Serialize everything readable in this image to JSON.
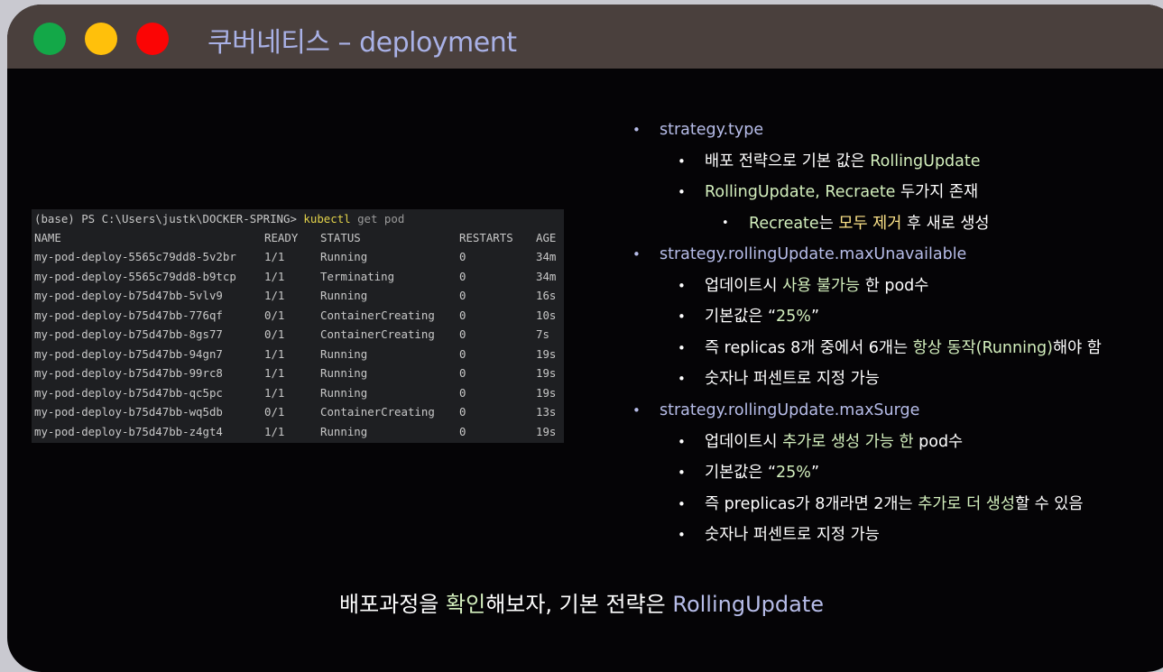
{
  "window": {
    "title": "쿠버네티스 – deployment"
  },
  "terminal": {
    "prompt": "(base) PS C:\\Users\\justk\\DOCKER-SPRING> ",
    "command": "kubectl",
    "args": " get pod",
    "headers": [
      "NAME",
      "READY",
      "STATUS",
      "RESTARTS",
      "AGE"
    ],
    "rows": [
      [
        "my-pod-deploy-5565c79dd8-5v2br",
        "1/1",
        "Running",
        "0",
        "34m"
      ],
      [
        "my-pod-deploy-5565c79dd8-b9tcp",
        "1/1",
        "Terminating",
        "0",
        "34m"
      ],
      [
        "my-pod-deploy-b75d47bb-5vlv9",
        "1/1",
        "Running",
        "0",
        "16s"
      ],
      [
        "my-pod-deploy-b75d47bb-776qf",
        "0/1",
        "ContainerCreating",
        "0",
        "10s"
      ],
      [
        "my-pod-deploy-b75d47bb-8gs77",
        "0/1",
        "ContainerCreating",
        "0",
        "7s"
      ],
      [
        "my-pod-deploy-b75d47bb-94gn7",
        "1/1",
        "Running",
        "0",
        "19s"
      ],
      [
        "my-pod-deploy-b75d47bb-99rc8",
        "1/1",
        "Running",
        "0",
        "19s"
      ],
      [
        "my-pod-deploy-b75d47bb-qc5pc",
        "1/1",
        "Running",
        "0",
        "19s"
      ],
      [
        "my-pod-deploy-b75d47bb-wq5db",
        "0/1",
        "ContainerCreating",
        "0",
        "13s"
      ],
      [
        "my-pod-deploy-b75d47bb-z4gt4",
        "1/1",
        "Running",
        "0",
        "19s"
      ]
    ]
  },
  "notes": {
    "bullet_l1": "•",
    "bullet_l2": "•",
    "bullet_l3": "•",
    "items": [
      {
        "level": 1,
        "parts": [
          {
            "text": "strategy.type",
            "color": "blue"
          }
        ]
      },
      {
        "level": 2,
        "parts": [
          {
            "text": "배포 전략으로 기본 값은 ",
            "color": "white"
          },
          {
            "text": "RollingUpdate",
            "color": "green"
          }
        ]
      },
      {
        "level": 2,
        "parts": [
          {
            "text": "RollingUpdate, Recraete",
            "color": "green"
          },
          {
            "text": " 두가지 존재",
            "color": "white"
          }
        ]
      },
      {
        "level": 3,
        "parts": [
          {
            "text": "Recreate",
            "color": "green"
          },
          {
            "text": "는 ",
            "color": "white"
          },
          {
            "text": "모두 제거",
            "color": "yellow"
          },
          {
            "text": " 후 새로 생성",
            "color": "white"
          }
        ]
      },
      {
        "level": 1,
        "parts": [
          {
            "text": "strategy.rollingUpdate.maxUnavailable",
            "color": "blue"
          }
        ]
      },
      {
        "level": 2,
        "parts": [
          {
            "text": "업데이트시 ",
            "color": "white"
          },
          {
            "text": "사용 불가능",
            "color": "green"
          },
          {
            "text": " 한 pod수",
            "color": "white"
          }
        ]
      },
      {
        "level": 2,
        "parts": [
          {
            "text": "기본값은 “",
            "color": "white"
          },
          {
            "text": "25%",
            "color": "green"
          },
          {
            "text": "”",
            "color": "white"
          }
        ]
      },
      {
        "level": 2,
        "parts": [
          {
            "text": "즉 replicas 8개 중에서 6개는 ",
            "color": "white"
          },
          {
            "text": "항상 동작(Running)",
            "color": "green"
          },
          {
            "text": "해야 함",
            "color": "white"
          }
        ]
      },
      {
        "level": 2,
        "parts": [
          {
            "text": "숫자나 퍼센트로 지정 가능",
            "color": "white"
          }
        ]
      },
      {
        "level": 1,
        "parts": [
          {
            "text": "strategy.rollingUpdate.maxSurge",
            "color": "blue"
          }
        ]
      },
      {
        "level": 2,
        "parts": [
          {
            "text": "업데이트시 ",
            "color": "white"
          },
          {
            "text": "추가로 생성 가능 한",
            "color": "green"
          },
          {
            "text": " pod수",
            "color": "white"
          }
        ]
      },
      {
        "level": 2,
        "parts": [
          {
            "text": "기본값은 “",
            "color": "white"
          },
          {
            "text": "25%",
            "color": "green"
          },
          {
            "text": "”",
            "color": "white"
          }
        ]
      },
      {
        "level": 2,
        "parts": [
          {
            "text": "즉 preplicas가 8개라면 2개는 ",
            "color": "white"
          },
          {
            "text": "추가로 더 생성",
            "color": "green"
          },
          {
            "text": "할 수 있음",
            "color": "white"
          }
        ]
      },
      {
        "level": 2,
        "parts": [
          {
            "text": "숫자나 퍼센트로 지정 가능",
            "color": "white"
          }
        ]
      }
    ]
  },
  "footer": {
    "parts": [
      {
        "text": "배포과정을 ",
        "color": "white"
      },
      {
        "text": "확인",
        "color": "green"
      },
      {
        "text": "해보자, 기본 전략은 ",
        "color": "white"
      },
      {
        "text": "RollingUpdate",
        "color": "blue"
      }
    ]
  },
  "colors": {
    "titlebar": "#4a403d",
    "background": "#050406",
    "terminal_bg": "#1e1f22",
    "blue_text": "#b7bde9",
    "green_text": "#d3efbd",
    "yellow_text": "#ffe58a",
    "command_yellow": "#e2d24a",
    "dot_green": "#13a848",
    "dot_yellow": "#ffc00b",
    "dot_red": "#fb0505"
  }
}
